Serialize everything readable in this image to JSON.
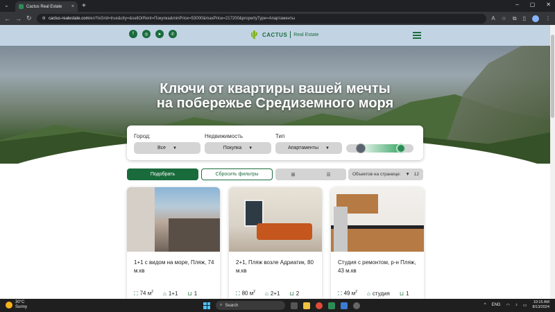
{
  "browser": {
    "tab_title": "Cactus Real Estate",
    "tab_close": "×",
    "new_tab": "+",
    "url_domain": "cactus-realestate.com",
    "url_path": "/en?isGrid=true&city=&sellOrRent=Покупка&minPrice=53000&maxPrice=217200&propertyType=Апартаменты"
  },
  "site": {
    "brand": "CACTUS",
    "brand_sub": "Real Estate",
    "hero_line1": "Ключи от квартиры вашей мечты",
    "hero_line2": "на побережье Средиземного моря"
  },
  "filters": {
    "city_label": "Город:",
    "city_value": "Все",
    "realty_label": "Недвижимость",
    "realty_value": "Покупка",
    "type_label": "Тип",
    "type_value": "Апартаменты",
    "price_min_fraction": 0.15,
    "price_max_fraction": 0.8
  },
  "actions": {
    "apply": "Подобрать",
    "reset": "Сбросить фильтры",
    "per_page_label": "Объектов на странице:",
    "per_page_value": "12"
  },
  "listings": [
    {
      "title": "1+1 с видом на море, Пляж, 74 м.кв",
      "area": "74 м",
      "rooms": "1+1",
      "baths": "1"
    },
    {
      "title": "2+1, Пляж возле Адриатик, 80 м.кв",
      "area": "80 м",
      "rooms": "2+1",
      "baths": "2"
    },
    {
      "title": "Студия с ремонтом, р-н Пляж, 43 м.кв",
      "area": "49 м",
      "rooms": "студия",
      "baths": "1"
    }
  ],
  "taskbar": {
    "temp": "30°C",
    "weather": "Sunny",
    "search": "Search",
    "lang": "ENG",
    "time": "10:15 AM",
    "date": "8/13/2024"
  },
  "colors": {
    "accent": "#1a6b3c",
    "header_bg": "#c2d4e3"
  }
}
